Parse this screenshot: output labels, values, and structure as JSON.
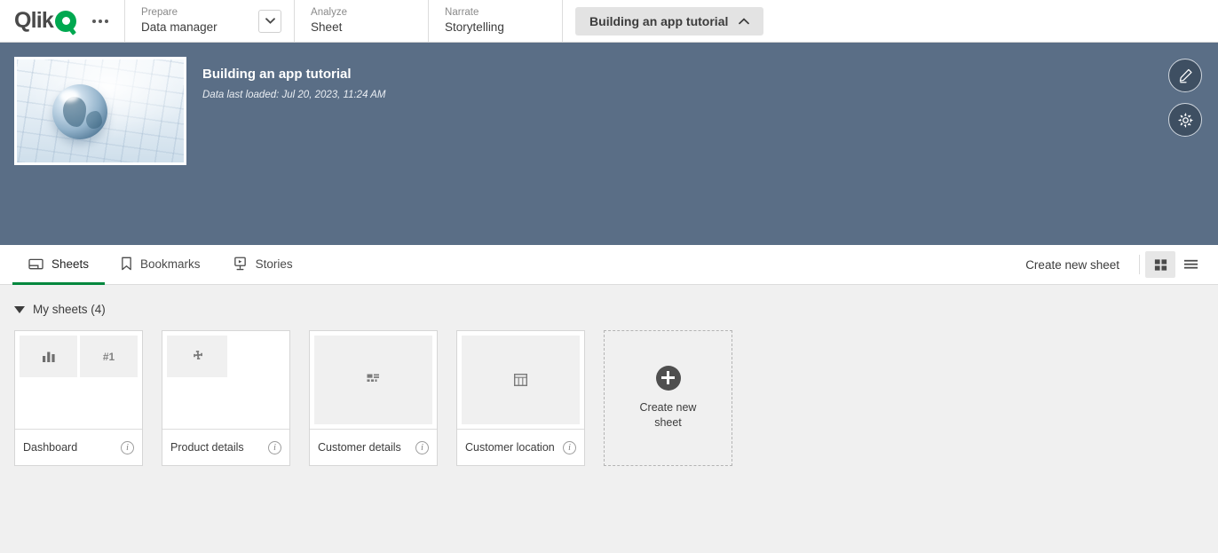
{
  "topnav": {
    "logo_text": "Qlik",
    "overflow_label": "more-options",
    "menus": [
      {
        "eyebrow": "Prepare",
        "label": "Data manager",
        "has_chevron": true
      },
      {
        "eyebrow": "Analyze",
        "label": "Sheet",
        "has_chevron": false
      },
      {
        "eyebrow": "Narrate",
        "label": "Storytelling",
        "has_chevron": false
      }
    ],
    "app_pill": {
      "label": "Building an app tutorial",
      "chevron": "chevron-up"
    }
  },
  "app_header": {
    "title": "Building an app tutorial",
    "subtitle": "Data last loaded: Jul 20, 2023, 11:24 AM",
    "thumbnail_alt": "globe on keyboard",
    "band_color": "#5a6e86",
    "actions": [
      {
        "name": "edit-app-button",
        "icon": "pencil-icon"
      },
      {
        "name": "app-settings-button",
        "icon": "gear-icon"
      }
    ]
  },
  "tabbar": {
    "tabs": [
      {
        "label": "Sheets",
        "icon": "sheet-icon",
        "active": true
      },
      {
        "label": "Bookmarks",
        "icon": "bookmark-icon",
        "active": false
      },
      {
        "label": "Stories",
        "icon": "story-icon",
        "active": false
      }
    ],
    "create_new_sheet": "Create new sheet",
    "views": [
      {
        "name": "grid-view-button",
        "icon": "grid-icon",
        "active": true
      },
      {
        "name": "list-view-button",
        "icon": "list-icon",
        "active": false
      }
    ],
    "active_accent": "#00873d"
  },
  "sheets_section": {
    "heading": "My sheets (4)",
    "expanded": true,
    "sheets": [
      {
        "name": "Dashboard",
        "info": "i",
        "thumb": "barchart-and-kpi",
        "kpi_text": "#1"
      },
      {
        "name": "Product details",
        "info": "i",
        "thumb": "puzzle"
      },
      {
        "name": "Customer details",
        "info": "i",
        "thumb": "filterpane"
      },
      {
        "name": "Customer location",
        "info": "i",
        "thumb": "table"
      }
    ],
    "create_card": {
      "label": "Create new sheet",
      "icon": "plus-circle-icon"
    }
  }
}
